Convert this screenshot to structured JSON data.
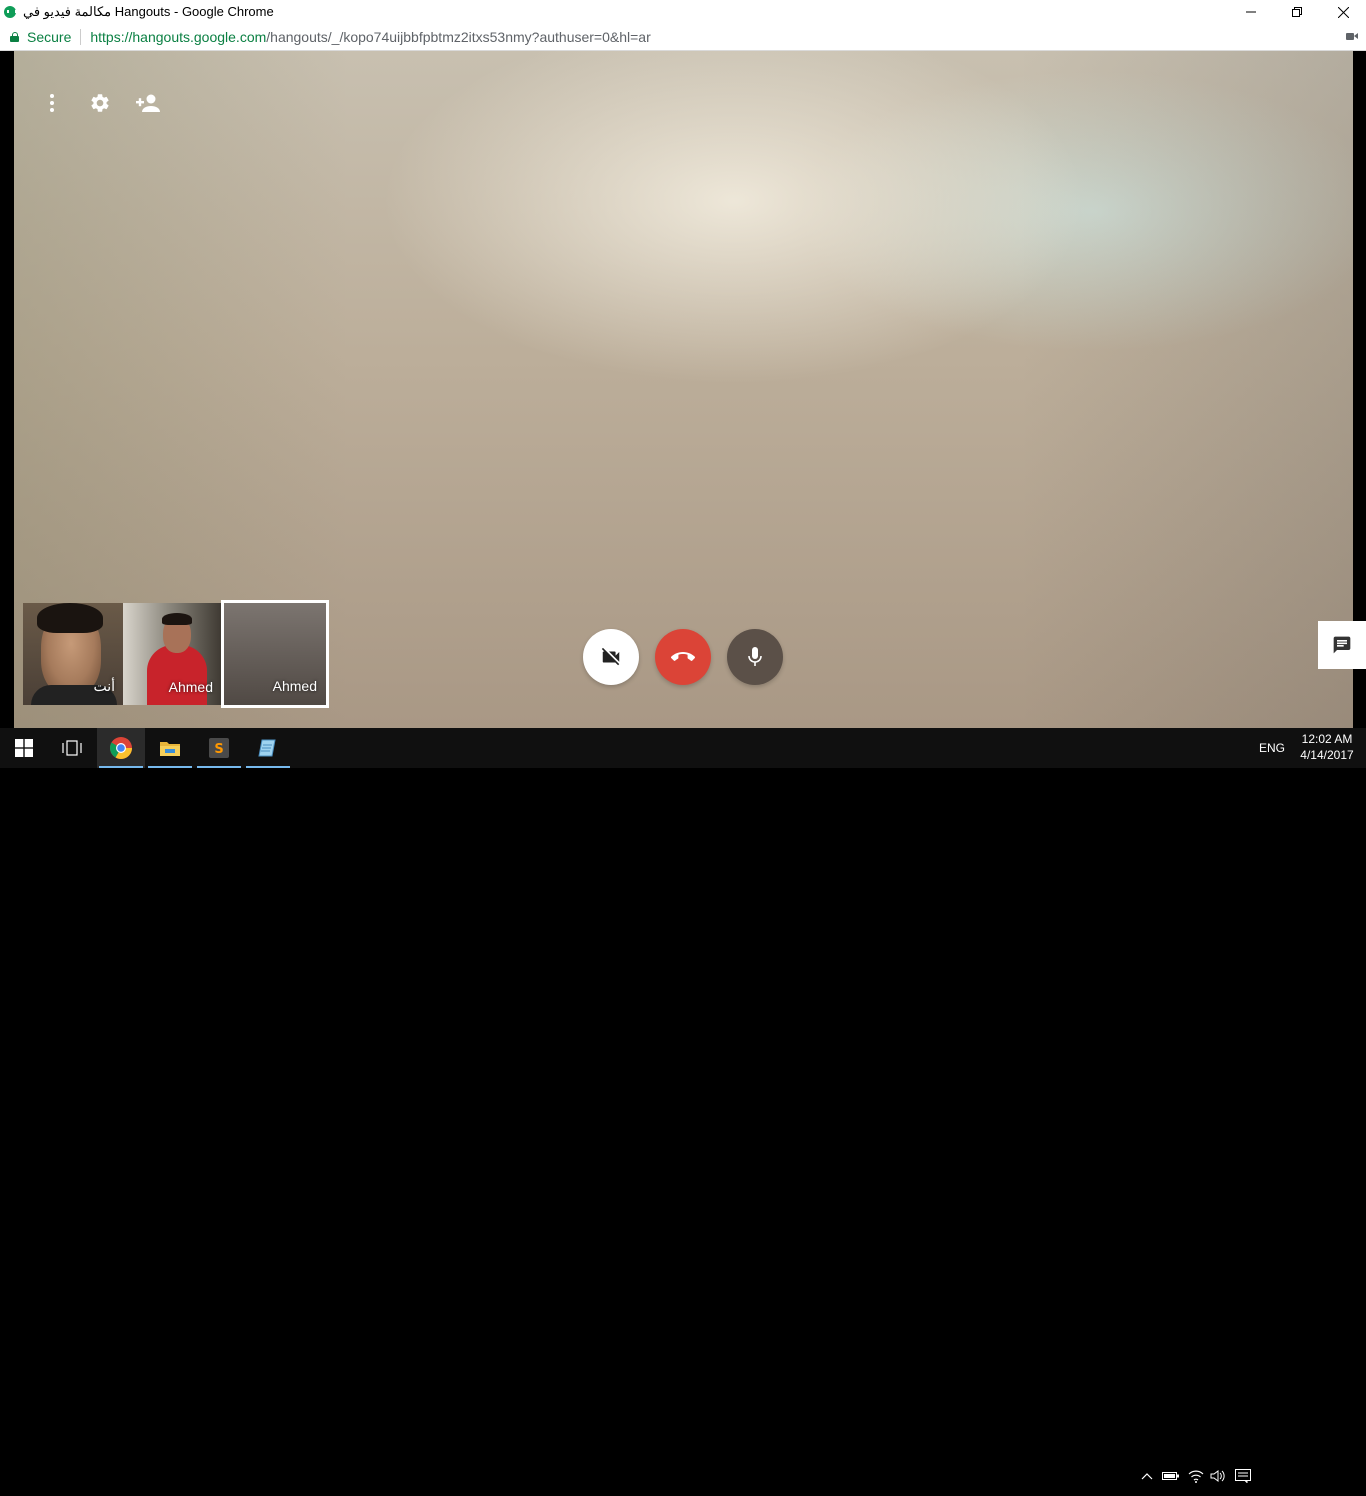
{
  "window": {
    "title": "مكالمة فيديو في Hangouts - Google Chrome",
    "controls": {
      "minimize": "—",
      "restore": "❐",
      "close": "✕"
    }
  },
  "addressbar": {
    "secure_label": "Secure",
    "url_scheme": "https://",
    "url_host": "hangouts.google.com",
    "url_path": "/hangouts/_/kopo74uijbbfpbtmz2itxs53nmy?authuser=0&hl=ar"
  },
  "video": {
    "top_controls": [
      "more-options",
      "settings",
      "add-people"
    ]
  },
  "participants": [
    {
      "name": "أنت"
    },
    {
      "name": "Ahmed"
    },
    {
      "name": "Ahmed"
    }
  ],
  "call_controls": {
    "video_off_color": "#ffffff",
    "hangup_color": "#db4437",
    "mic_color": "#5b5048"
  },
  "taskbar": {
    "apps": [
      "start",
      "task-view",
      "chrome",
      "file-explorer",
      "sublime-text",
      "notepad"
    ],
    "language": "ENG",
    "time": "12:02 AM",
    "date": "4/14/2017"
  }
}
